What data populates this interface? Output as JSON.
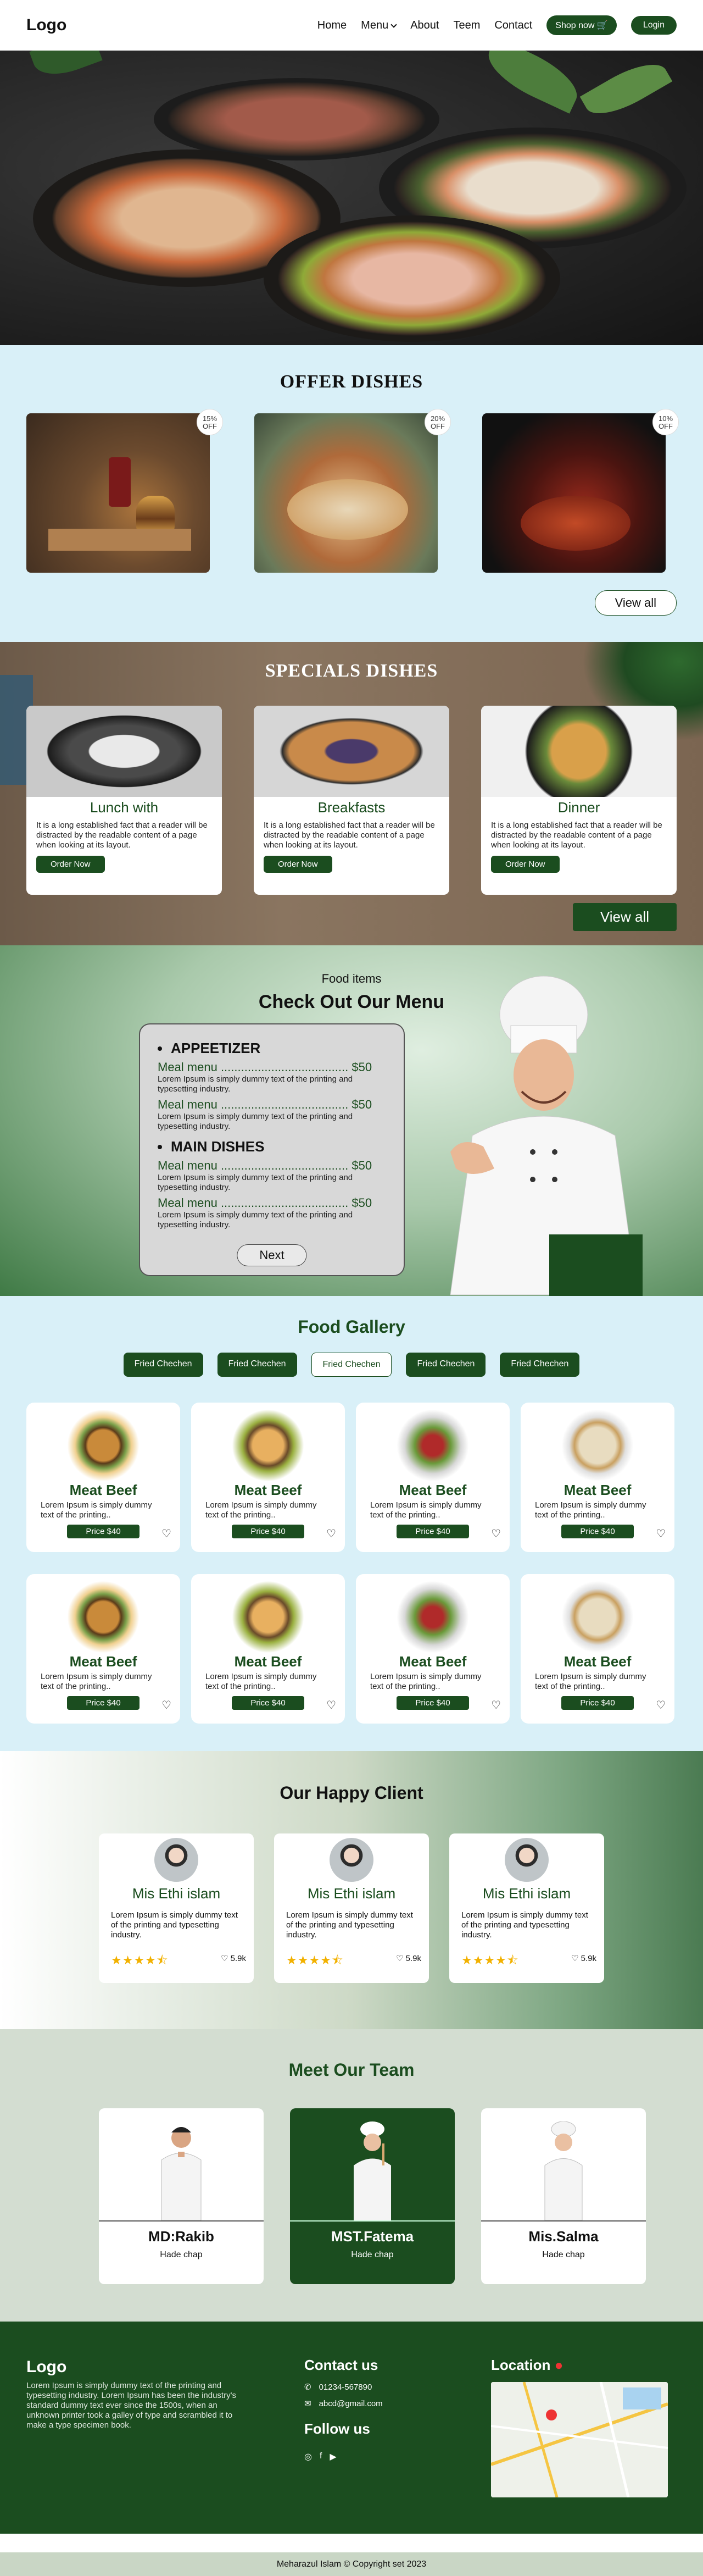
{
  "nav": {
    "logo": "Logo",
    "links": [
      "Home",
      "Menu",
      "About",
      "Teem",
      "Contact"
    ],
    "shop_now": "Shop now",
    "login": "Login"
  },
  "offer": {
    "title": "OFFER DISHES",
    "cards": [
      {
        "badge": "15%\nOFF"
      },
      {
        "badge": "20%\nOFF"
      },
      {
        "badge": "10%\nOFF"
      }
    ],
    "view_all": "View all"
  },
  "specials": {
    "title": "SPECIALS DISHES",
    "cards": [
      {
        "title": "Lunch with",
        "text": "It is a long established fact that a reader will be distracted by the readable content of a page when looking at its layout.",
        "button": "Order Now"
      },
      {
        "title": "Breakfasts",
        "text": "It is a long established fact that a reader will be distracted by the readable content of a page when looking at its layout.",
        "button": "Order Now"
      },
      {
        "title": "Dinner",
        "text": "It is a long established fact that a reader will be distracted by the readable content of a page when looking at its layout.",
        "button": "Order Now"
      }
    ],
    "view_all": "View all"
  },
  "menu": {
    "kicker": "Food items",
    "title": "Check Out Our Menu",
    "sections": [
      {
        "heading": "APPEETIZER",
        "items": [
          {
            "name": "Meal menu ......................................",
            "price": "$50",
            "desc": "Lorem Ipsum is simply dummy text of the printing and typesetting industry."
          },
          {
            "name": "Meal menu ......................................",
            "price": "$50",
            "desc": "Lorem Ipsum is simply dummy text of the printing and typesetting industry."
          }
        ]
      },
      {
        "heading": "MAIN DISHES",
        "items": [
          {
            "name": "Meal menu ......................................",
            "price": "$50",
            "desc": "Lorem Ipsum is simply dummy text of the printing and typesetting industry."
          },
          {
            "name": "Meal menu ......................................",
            "price": "$50",
            "desc": "Lorem Ipsum is simply dummy text of the printing and typesetting industry."
          }
        ]
      }
    ],
    "next": "Next"
  },
  "gallery": {
    "title": "Food Gallery",
    "tabs": [
      "Fried Chechen",
      "Fried Chechen",
      "Fried Chechen",
      "Fried Chechen",
      "Fried Chechen"
    ],
    "active_tab": 2,
    "cards": [
      {
        "title": "Meat Beef",
        "text": "Lorem Ipsum is simply dummy text of the printing..",
        "price": "Price $40"
      },
      {
        "title": "Meat Beef",
        "text": "Lorem Ipsum is simply dummy text of the printing..",
        "price": "Price $40"
      },
      {
        "title": "Meat Beef",
        "text": "Lorem Ipsum is simply dummy text of the printing..",
        "price": "Price $40"
      },
      {
        "title": "Meat Beef",
        "text": "Lorem Ipsum is simply dummy text of the printing..",
        "price": "Price $40"
      },
      {
        "title": "Meat Beef",
        "text": "Lorem Ipsum is simply dummy text of the printing..",
        "price": "Price $40"
      },
      {
        "title": "Meat Beef",
        "text": "Lorem Ipsum is simply dummy text of the printing..",
        "price": "Price $40"
      },
      {
        "title": "Meat Beef",
        "text": "Lorem Ipsum is simply dummy text of the printing..",
        "price": "Price $40"
      },
      {
        "title": "Meat Beef",
        "text": "Lorem Ipsum is simply dummy text of the printing..",
        "price": "Price $40"
      }
    ]
  },
  "clients": {
    "title": "Our Happy Client",
    "cards": [
      {
        "name": "Mis Ethi islam",
        "text": "Lorem Ipsum is simply dummy text of the printing and typesetting industry.",
        "likes": "5.9k",
        "rating": 4.5
      },
      {
        "name": "Mis Ethi islam",
        "text": "Lorem Ipsum is simply dummy text of the printing and typesetting industry.",
        "likes": "5.9k",
        "rating": 4.5
      },
      {
        "name": "Mis Ethi islam",
        "text": "Lorem Ipsum is simply dummy text of the printing and typesetting industry.",
        "likes": "5.9k",
        "rating": 4.5
      }
    ]
  },
  "team": {
    "title": "Meet Our Team",
    "members": [
      {
        "name": "MD:Rakib",
        "role": "Hade chap"
      },
      {
        "name": "MST.Fatema",
        "role": "Hade chap"
      },
      {
        "name": "Mis.Salma",
        "role": "Hade chap"
      }
    ]
  },
  "footer": {
    "logo": "Logo",
    "text": "Lorem Ipsum is simply dummy text of the printing and typesetting industry. Lorem Ipsum has been the industry's standard dummy text ever since the 1500s, when an unknown printer took a galley of type and scrambled it to make a type specimen book.",
    "contact_title": "Contact us",
    "phone": "01234-567890",
    "email": "abcd@gmail.com",
    "follow_title": "Follow us",
    "location_title": "Location",
    "copyright": "Meharazul Islam © Copyright set 2023"
  },
  "colors": {
    "brand_green": "#1b4d1f",
    "light_blue": "#d9f0f8",
    "star": "#f2b100"
  }
}
